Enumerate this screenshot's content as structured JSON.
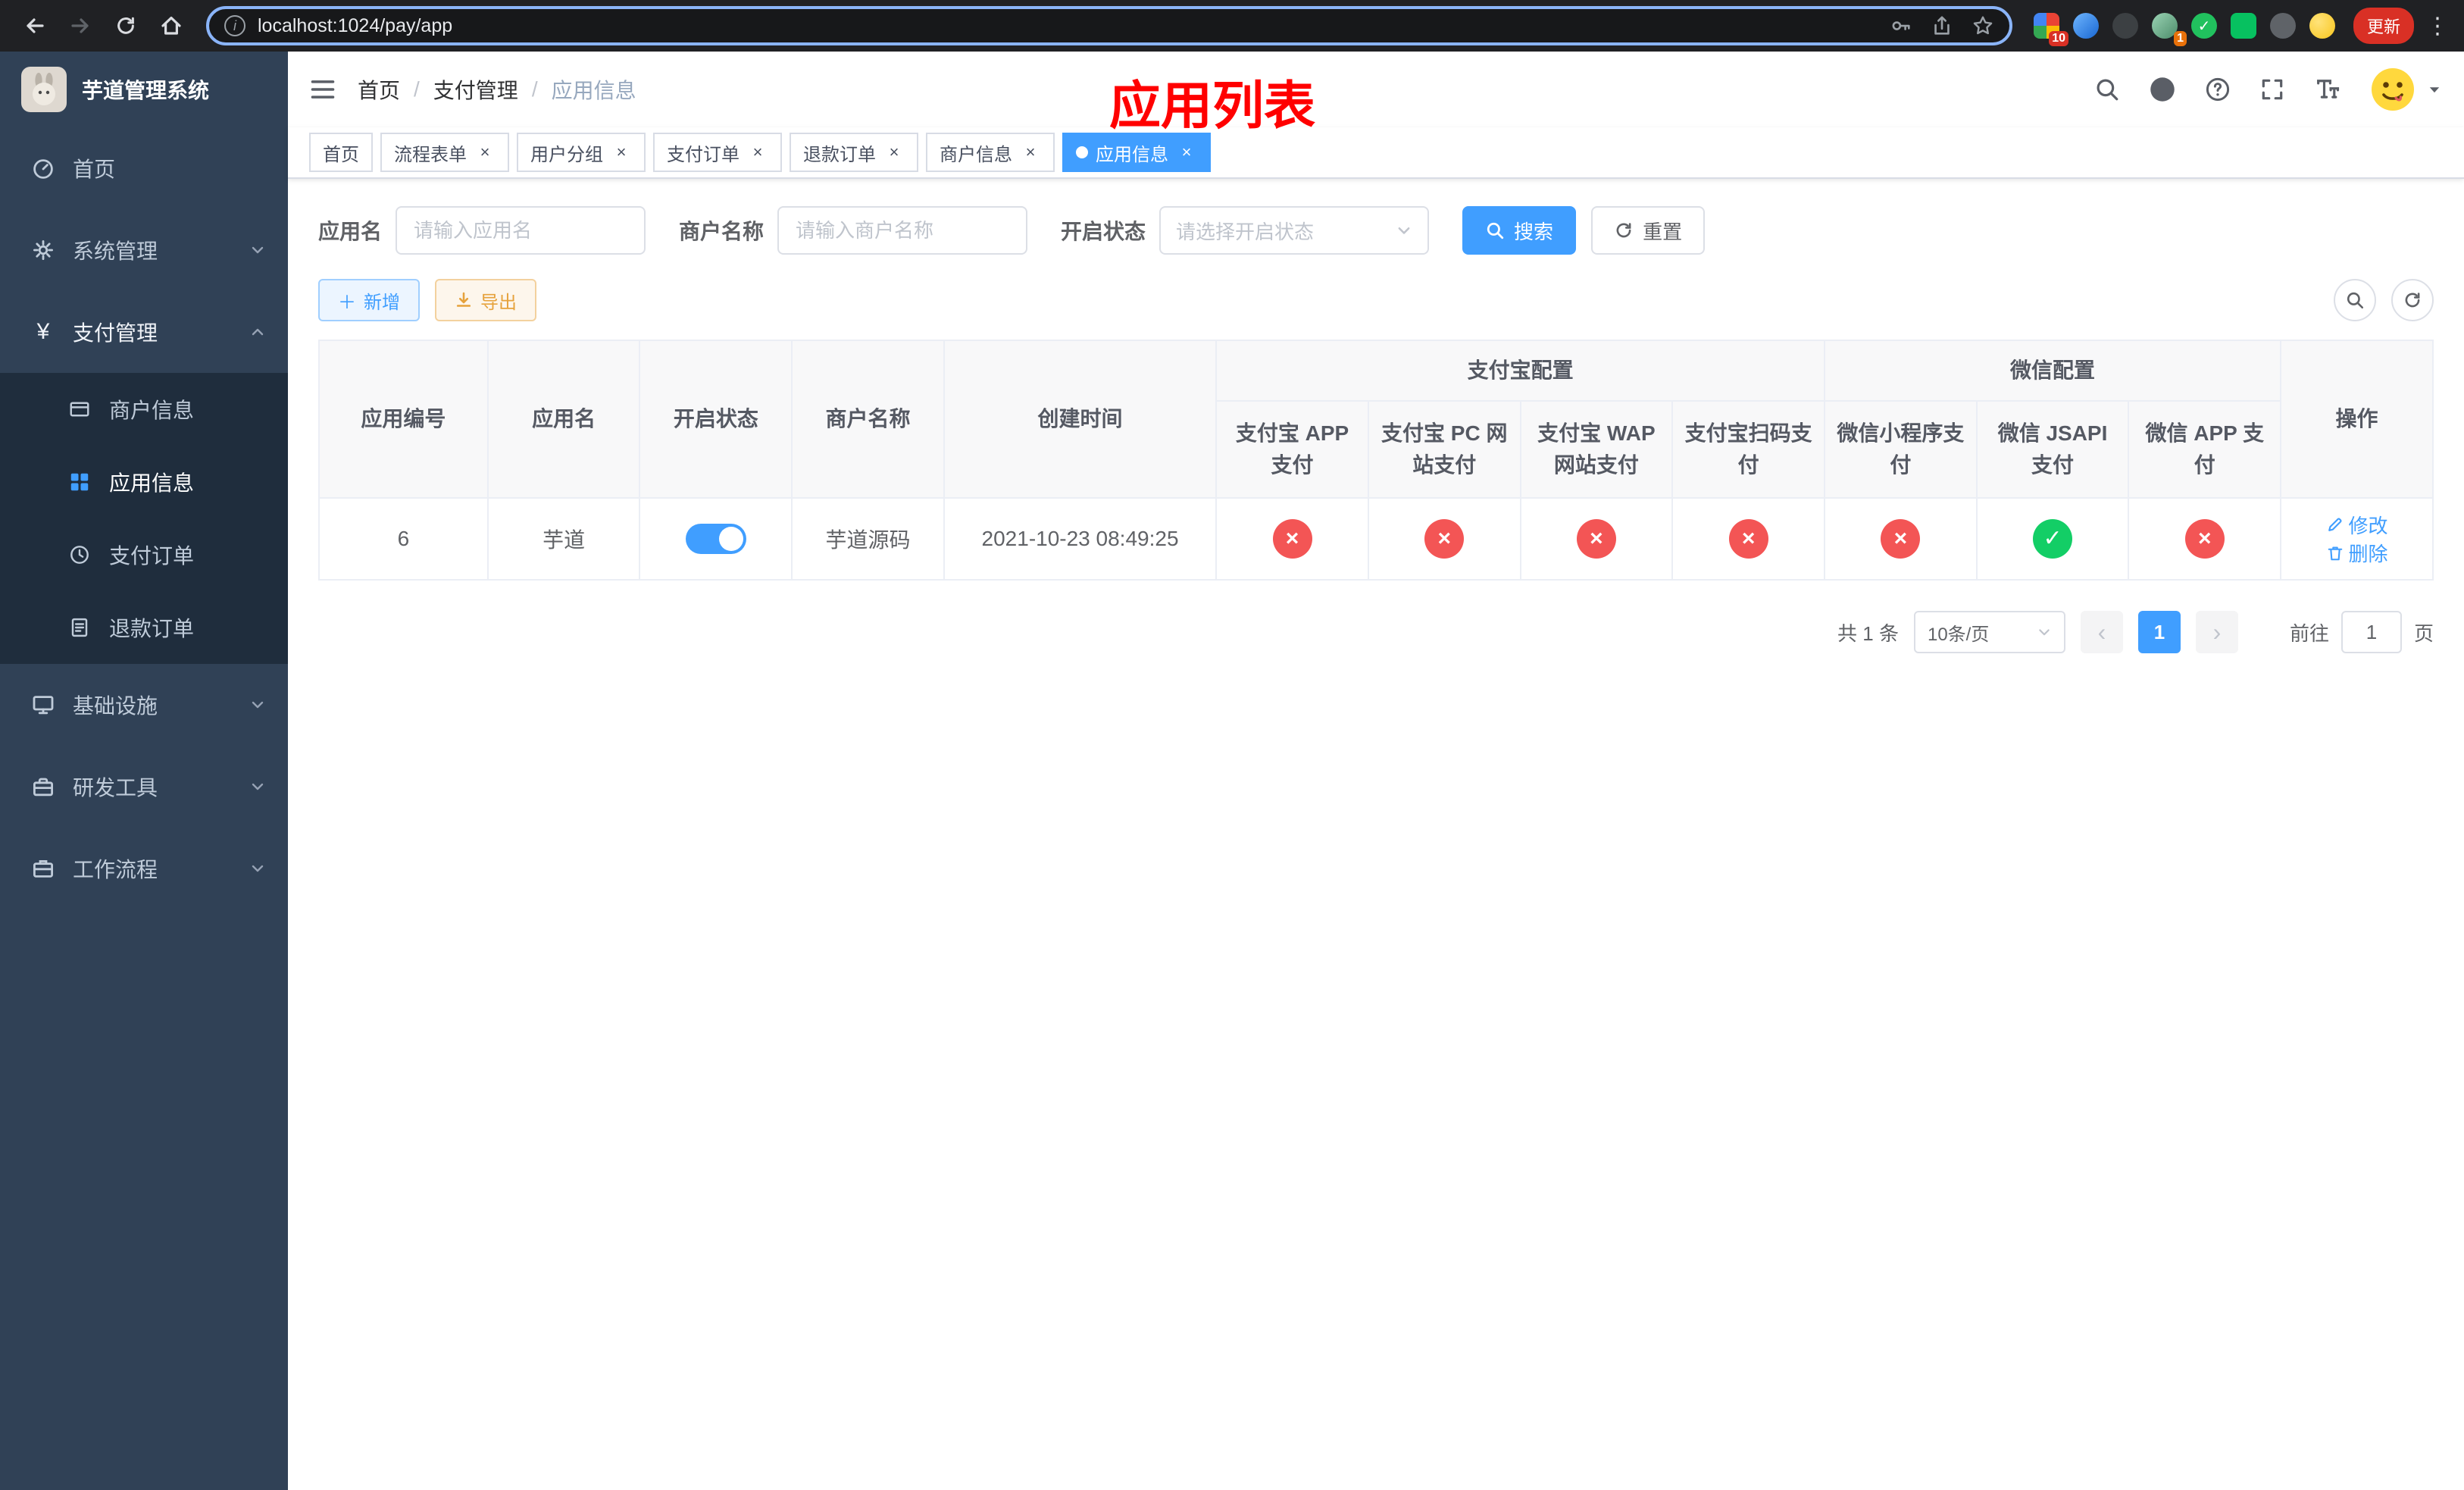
{
  "colors": {
    "accent": "#409eff",
    "success": "#13ce66",
    "danger": "#f35555",
    "sidebar_bg": "#304156",
    "sidebar_submenu_bg": "#1f2d3d",
    "annotation_red": "#ff0000"
  },
  "browser": {
    "url": "localhost:1024/pay/app",
    "update_label": "更新",
    "extension_badges": {
      "first": "10",
      "second": "1"
    }
  },
  "sidebar": {
    "title": "芋道管理系统",
    "items": [
      {
        "label": "首页"
      },
      {
        "label": "系统管理"
      },
      {
        "label": "支付管理"
      },
      {
        "label": "基础设施"
      },
      {
        "label": "研发工具"
      },
      {
        "label": "工作流程"
      }
    ],
    "payment_children": [
      {
        "label": "商户信息"
      },
      {
        "label": "应用信息"
      },
      {
        "label": "支付订单"
      },
      {
        "label": "退款订单"
      }
    ]
  },
  "navbar": {
    "breadcrumb": [
      {
        "label": "首页"
      },
      {
        "label": "支付管理"
      },
      {
        "label": "应用信息"
      }
    ],
    "breadcrumb_separator": "/",
    "annotation_title": "应用列表"
  },
  "tags": [
    {
      "label": "首页"
    },
    {
      "label": "流程表单"
    },
    {
      "label": "用户分组"
    },
    {
      "label": "支付订单"
    },
    {
      "label": "退款订单"
    },
    {
      "label": "商户信息"
    },
    {
      "label": "应用信息"
    }
  ],
  "filters": {
    "app_name": {
      "label": "应用名",
      "placeholder": "请输入应用名",
      "value": ""
    },
    "merchant_name": {
      "label": "商户名称",
      "placeholder": "请输入商户名称",
      "value": ""
    },
    "status": {
      "label": "开启状态",
      "placeholder": "请选择开启状态",
      "value": ""
    },
    "search_label": "搜索",
    "reset_label": "重置"
  },
  "toolbar": {
    "add_label": "新增",
    "export_label": "导出"
  },
  "table": {
    "groups": {
      "alipay": "支付宝配置",
      "wechat": "微信配置"
    },
    "columns": {
      "id": "应用编号",
      "name": "应用名",
      "status": "开启状态",
      "merchant": "商户名称",
      "created": "创建时间",
      "alipay_app": "支付宝 APP 支付",
      "alipay_pc": "支付宝 PC 网站支付",
      "alipay_wap": "支付宝 WAP 网站支付",
      "alipay_qr": "支付宝扫码支付",
      "wx_mini": "微信小程序支付",
      "wx_jsapi": "微信 JSAPI 支付",
      "wx_app": "微信 APP 支付",
      "actions": "操作"
    },
    "rows": [
      {
        "id": "6",
        "name": "芋道",
        "status_enabled": true,
        "merchant": "芋道源码",
        "created": "2021-10-23 08:49:25",
        "alipay_app": "disabled",
        "alipay_pc": "disabled",
        "alipay_wap": "disabled",
        "alipay_qr": "disabled",
        "wx_mini": "disabled",
        "wx_jsapi": "enabled",
        "wx_app": "disabled",
        "edit_label": "修改",
        "delete_label": "删除"
      }
    ]
  },
  "pagination": {
    "total_text": "共 1 条",
    "page_size_label": "10条/页",
    "current_page": "1",
    "goto_label": "前往",
    "goto_value": "1",
    "unit_label": "页"
  }
}
